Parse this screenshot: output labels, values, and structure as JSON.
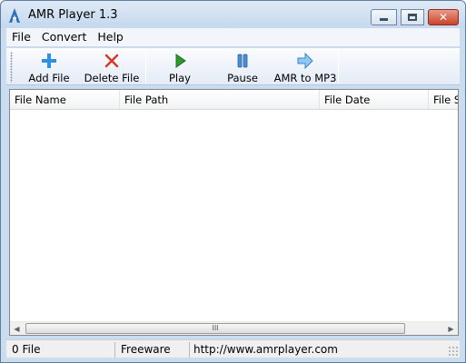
{
  "window": {
    "title": "AMR Player 1.3",
    "close_glyph": "✕",
    "icons": {
      "app": "amr-player-logo-icon",
      "minimize": "minimize-icon",
      "maximize": "maximize-icon",
      "close": "close-icon"
    }
  },
  "menu": {
    "items": [
      {
        "label": "File"
      },
      {
        "label": "Convert"
      },
      {
        "label": "Help"
      }
    ]
  },
  "toolbar": {
    "buttons": [
      {
        "label": "Add File",
        "icon": "plus-icon",
        "color": "#2f8fe0"
      },
      {
        "label": "Delete File",
        "icon": "red-x-icon",
        "color": "#d53a2a"
      },
      {
        "label": "Play",
        "icon": "play-icon",
        "color": "#2e9a2e"
      },
      {
        "label": "Pause",
        "icon": "pause-icon",
        "color": "#4a8fd6"
      },
      {
        "label": "AMR to MP3",
        "icon": "arrow-right-icon",
        "color": "#57a9e8"
      }
    ]
  },
  "file_list": {
    "columns": [
      "File Name",
      "File Path",
      "File Date",
      "File Si"
    ],
    "rows": []
  },
  "scrollbar": {
    "left_arrow": "◀",
    "right_arrow": "▶",
    "thumb_grip": "III"
  },
  "status": {
    "file_count": "0 File",
    "license": "Freeware",
    "website": "http://www.amrplayer.com"
  },
  "colors": {
    "frame": "#c9dcf0",
    "close_button": "#c8442a"
  }
}
